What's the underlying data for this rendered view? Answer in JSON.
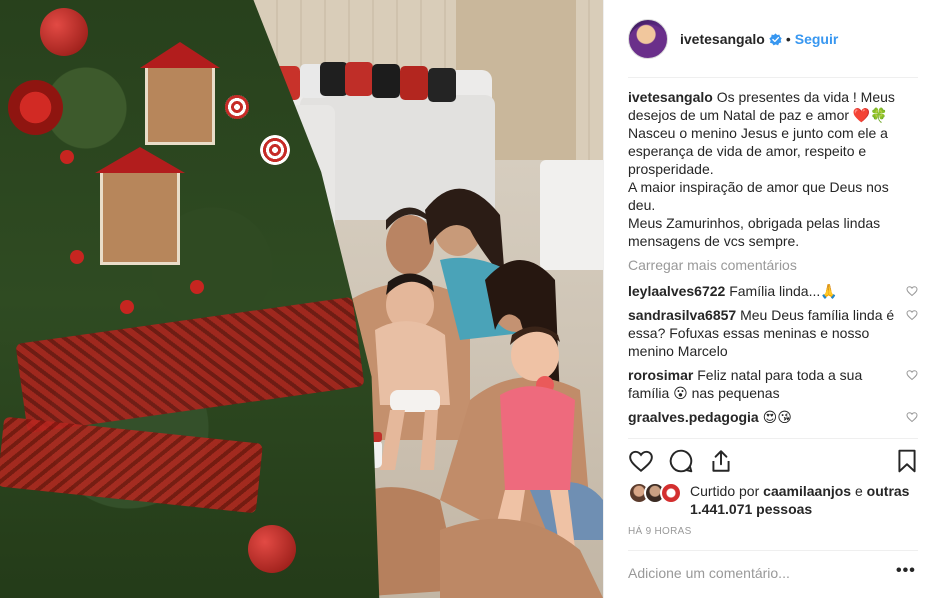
{
  "colors": {
    "link": "#3897f0",
    "text": "#262626",
    "muted": "#999999",
    "verified": "#3897f0",
    "heart_red": "#ed4956"
  },
  "photo": {
    "description_icon": "family-christmas-photo"
  },
  "header": {
    "username": "ivetesangalo",
    "separator": "•",
    "follow_label": "Seguir"
  },
  "caption": {
    "username": "ivetesangalo",
    "lines": [
      "Os presentes da vida ! Meus desejos de um Natal de paz e amor ❤️🍀",
      "Nasceu o menino Jesus e junto com ele a esperança de vida de amor, respeito e prosperidade.",
      "A maior inspiração de amor que Deus nos deu.",
      "Meus Zamurinhos, obrigada pelas lindas mensagens de vcs sempre."
    ]
  },
  "load_more_label": "Carregar mais comentários",
  "comments": [
    {
      "username": "leylaalves6722",
      "text": "Família linda...🙏"
    },
    {
      "username": "sandrasilva6857",
      "text": "Meu Deus família linda é essa? Fofuxas essas meninas e nosso menino Marcelo"
    },
    {
      "username": "rorosimar",
      "text": "Feliz natal para toda a sua família 😮 nas pequenas"
    },
    {
      "username": "graalves.pedagogia",
      "text": "😍😘"
    }
  ],
  "actions": {
    "like_icon": "heart-icon",
    "comment_icon": "comment-icon",
    "share_icon": "share-icon",
    "save_icon": "bookmark-icon"
  },
  "likes": {
    "prefix": "Curtido por",
    "liker": "caamilaanjos",
    "middle": "e",
    "others": "outras 1.441.071 pessoas"
  },
  "timestamp": "Há 9 horas",
  "add_comment": {
    "placeholder": "Adicione um comentário..."
  },
  "more_options": "•••"
}
